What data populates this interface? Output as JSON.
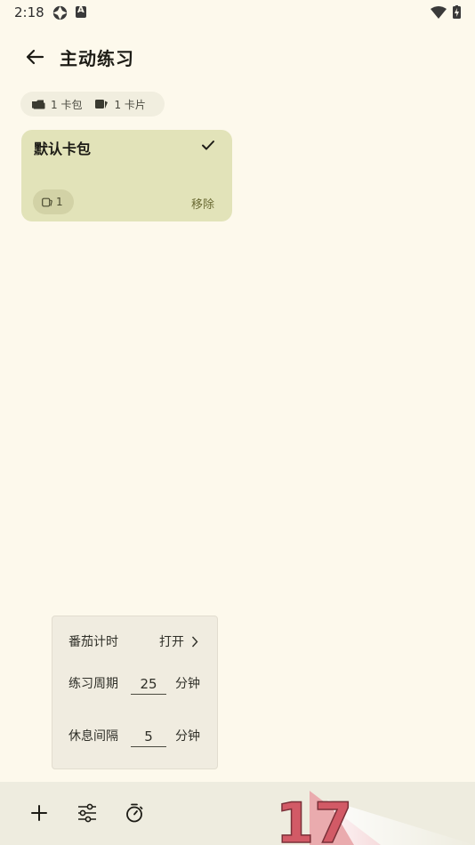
{
  "status_bar": {
    "time": "2:18",
    "icons": [
      "app-notification-icon",
      "app-a-icon",
      "wifi-icon",
      "battery-charging-icon"
    ]
  },
  "app_bar": {
    "back_icon": "arrow-back-icon",
    "title": "主动练习"
  },
  "stats": {
    "deck_count": "1 卡包",
    "card_count": "1 卡片"
  },
  "decks": [
    {
      "name": "默认卡包",
      "selected": true,
      "card_count": "1",
      "remove_label": "移除"
    }
  ],
  "pomodoro": {
    "title": "番茄计时",
    "toggle_label": "打开",
    "cycle_label": "练习周期",
    "cycle_value": "25",
    "cycle_unit": "分钟",
    "rest_label": "休息间隔",
    "rest_value": "5",
    "rest_unit": "分钟"
  },
  "bottom_bar": {
    "icons": [
      "add-icon",
      "tune-icon",
      "timer-icon"
    ],
    "watermark_text": "17"
  },
  "colors": {
    "background": "#fdf9ec",
    "card": "#e2e3b9",
    "accent_text": "#6b6b34",
    "panel": "#f0ece0",
    "bottom_bar": "#eeecdf"
  }
}
